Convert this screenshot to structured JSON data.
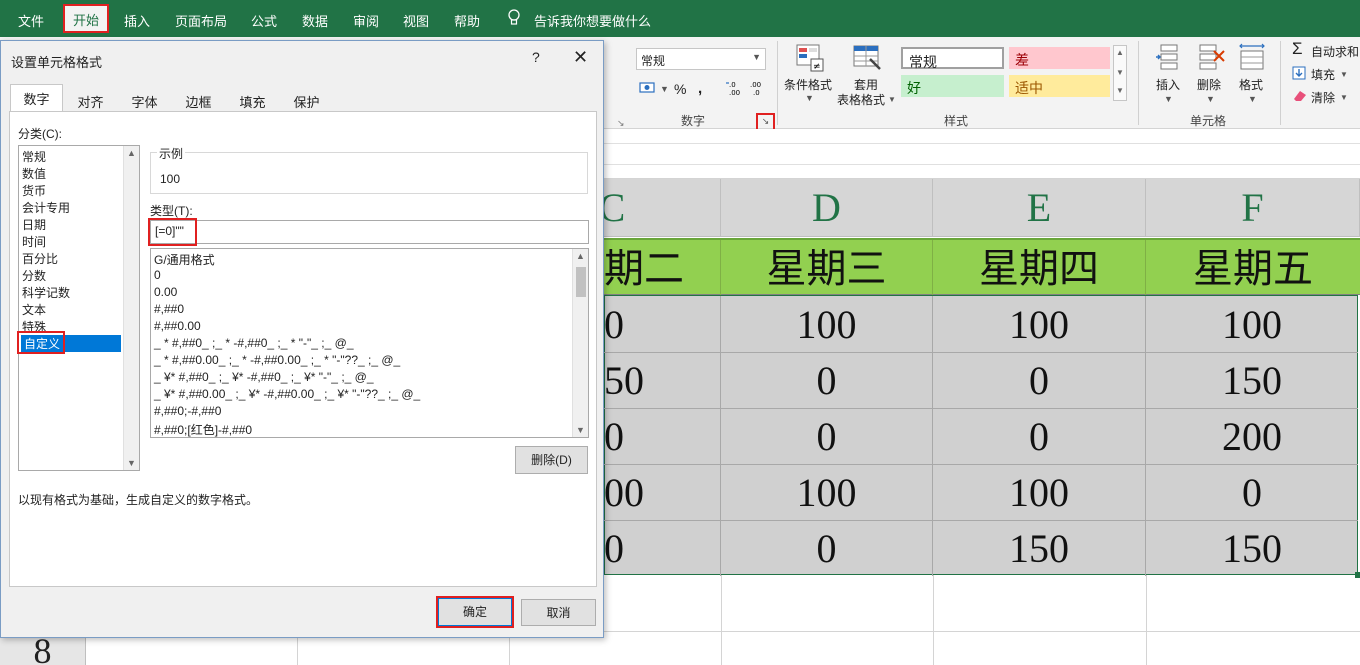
{
  "ribbon": {
    "tabs": [
      "文件",
      "开始",
      "插入",
      "页面布局",
      "公式",
      "数据",
      "审阅",
      "视图",
      "帮助"
    ],
    "tell_me": "告诉我你想要做什么",
    "number_group": {
      "format_value": "常规",
      "percent": "%",
      "label": "数字"
    },
    "styles_group": {
      "conditional_format": "条件格式",
      "table_format_line1": "套用",
      "table_format_line2": "表格格式",
      "normal": "常规",
      "bad": "差",
      "good": "好",
      "neutral": "适中",
      "label": "样式"
    },
    "cells_group": {
      "insert": "插入",
      "delete": "删除",
      "format": "格式",
      "label": "单元格"
    },
    "editing_group": {
      "autosum": "自动求和",
      "fill": "填充",
      "clear": "清除"
    },
    "colors": {
      "green": "#217346",
      "bad_bg": "#ffc7ce",
      "bad_fg": "#9c0006",
      "good_bg": "#c6efce",
      "good_fg": "#006100",
      "neutral_bg": "#ffeb9c",
      "neutral_fg": "#9c5700"
    }
  },
  "sheet": {
    "columns": [
      "C",
      "D",
      "E",
      "F"
    ],
    "headers": [
      "期二",
      "星期三",
      "星期四",
      "星期五"
    ],
    "rows": [
      [
        "0",
        "100",
        "100",
        "100"
      ],
      [
        "50",
        "0",
        "0",
        "150"
      ],
      [
        "0",
        "0",
        "0",
        "200"
      ],
      [
        "00",
        "100",
        "100",
        "0"
      ],
      [
        "0",
        "0",
        "150",
        "150"
      ]
    ],
    "row_number": "8",
    "header_bg": "#92d050"
  },
  "dialog": {
    "title": "设置单元格格式",
    "help": "?",
    "close": "✕",
    "tabs": [
      "数字",
      "对齐",
      "字体",
      "边框",
      "填充",
      "保护"
    ],
    "category_label": "分类(C):",
    "categories": [
      "常规",
      "数值",
      "货币",
      "会计专用",
      "日期",
      "时间",
      "百分比",
      "分数",
      "科学记数",
      "文本",
      "特殊",
      "自定义"
    ],
    "sample_label": "示例",
    "sample_value": "100",
    "type_label": "类型(T):",
    "type_value": "[=0]\"\"",
    "formats": [
      "G/通用格式",
      "0",
      "0.00",
      "#,##0",
      "#,##0.00",
      "_ * #,##0_ ;_ * -#,##0_ ;_ * \"-\"_ ;_ @_",
      "_ * #,##0.00_ ;_ * -#,##0.00_ ;_ * \"-\"??_ ;_ @_",
      "_ ¥* #,##0_ ;_ ¥* -#,##0_ ;_ ¥* \"-\"_ ;_ @_",
      "_ ¥* #,##0.00_ ;_ ¥* -#,##0.00_ ;_ ¥* \"-\"??_ ;_ @_",
      "#,##0;-#,##0",
      "#,##0;[红色]-#,##0"
    ],
    "delete_button": "删除(D)",
    "description": "以现有格式为基础，生成自定义的数字格式。",
    "ok_button": "确定",
    "cancel_button": "取消"
  }
}
